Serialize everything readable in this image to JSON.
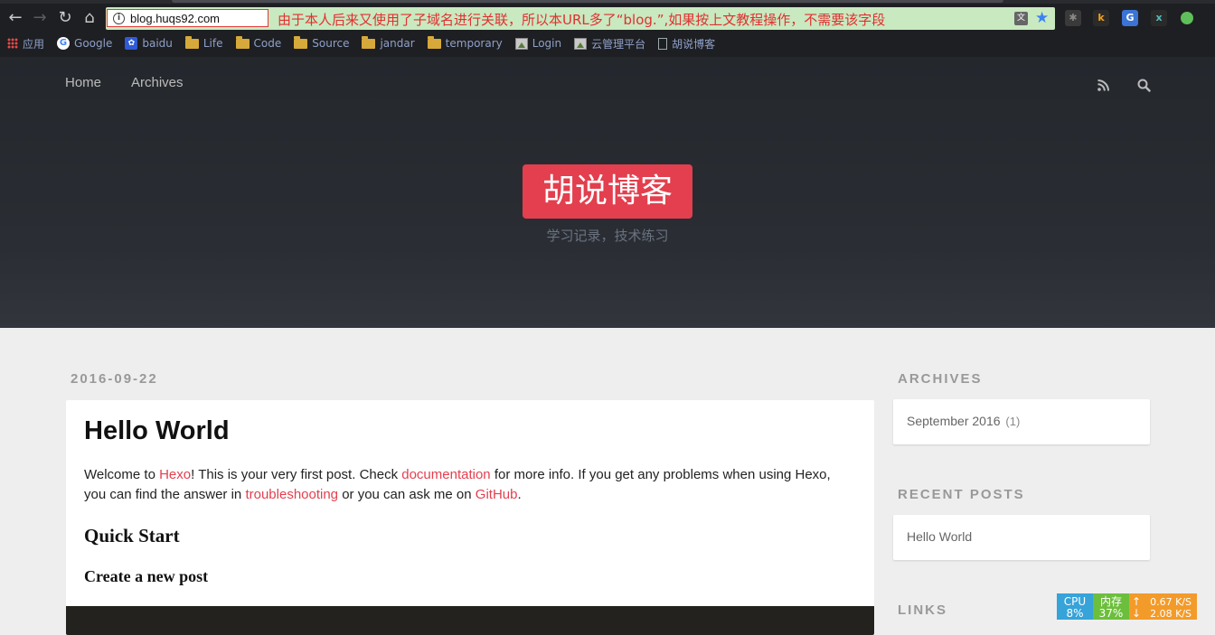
{
  "browser": {
    "url": "blog.huqs92.com",
    "annotation": "由于本人后来又使用了子域名进行关联，所以本URL多了“blog.”,如果按上文教程操作，不需要该字段",
    "bookmarks": [
      {
        "label": "应用",
        "icon": "apps-grid-icon"
      },
      {
        "label": "Google",
        "icon": "google-icon"
      },
      {
        "label": "baidu",
        "icon": "baidu-icon"
      },
      {
        "label": "Life",
        "icon": "folder-icon"
      },
      {
        "label": "Code",
        "icon": "folder-icon"
      },
      {
        "label": "Source",
        "icon": "folder-icon"
      },
      {
        "label": "jandar",
        "icon": "folder-icon"
      },
      {
        "label": "temporary",
        "icon": "folder-icon"
      },
      {
        "label": "Login",
        "icon": "page-image-icon"
      },
      {
        "label": "云管理平台",
        "icon": "page-image-icon"
      },
      {
        "label": "胡说博客",
        "icon": "document-icon"
      }
    ],
    "extensions": [
      {
        "icon": "bug-extension-icon",
        "color": "#3a3a3a"
      },
      {
        "icon": "k-extension-icon",
        "color": "#2b2b2b",
        "text": "k"
      },
      {
        "icon": "google-translate-icon",
        "color": "#3b74d6",
        "text": "G"
      },
      {
        "icon": "x-badge-extension-icon",
        "color": "#2a2a2a",
        "text": "x"
      },
      {
        "icon": "green-dot-extension-icon",
        "color": "#5fbf5a"
      }
    ]
  },
  "site": {
    "nav": [
      "Home",
      "Archives"
    ],
    "title": "胡说博客",
    "subtitle": "学习记录，技术练习",
    "accent": "#e33f4e"
  },
  "post": {
    "date": "2016-09-22",
    "title": "Hello World",
    "body": {
      "t1": "Welcome to ",
      "link_hexo": "Hexo",
      "t2": "! This is your very first post. Check ",
      "link_docs": "documentation",
      "t3": " for more info. If you get any problems when using Hexo, you can find the answer in ",
      "link_trouble": "troubleshooting",
      "t4": " or you can ask me on ",
      "link_github": "GitHub",
      "t5": "."
    },
    "h2": "Quick Start",
    "h3": "Create a new post"
  },
  "sidebar": {
    "archives_title": "ARCHIVES",
    "archive_item": "September 2016",
    "archive_count": "(1)",
    "recent_title": "RECENT POSTS",
    "recent_item": "Hello World",
    "links_title": "LINKS"
  },
  "sysmon": {
    "cpu_label": "CPU",
    "cpu_value": "8%",
    "mem_label": "内存",
    "mem_value": "37%",
    "net_up": "0.67 K/S",
    "net_down": "2.08 K/S"
  }
}
